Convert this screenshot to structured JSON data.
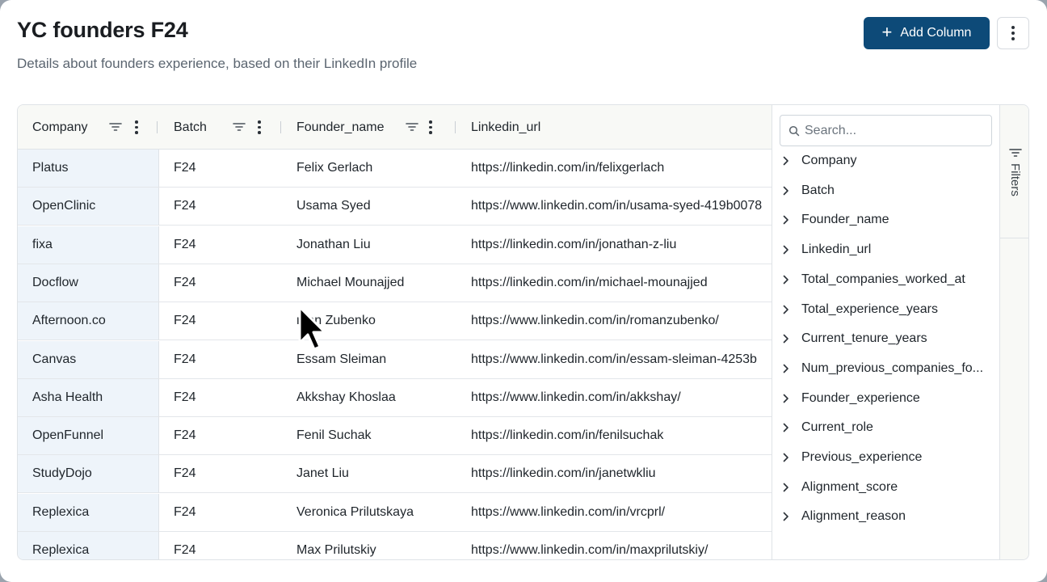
{
  "header": {
    "title": "YC founders F24",
    "subtitle": "Details about founders experience, based on their LinkedIn profile",
    "add_column_label": "Add Column"
  },
  "colors": {
    "primary_button": "#0d4a78",
    "first_column_bg": "#eef4fa",
    "header_bg": "#f8f9f6"
  },
  "table": {
    "columns": [
      "Company",
      "Batch",
      "Founder_name",
      "Linkedin_url"
    ],
    "rows": [
      {
        "company": "Platus",
        "batch": "F24",
        "founder": "Felix Gerlach",
        "linkedin": "https://linkedin.com/in/felixgerlach"
      },
      {
        "company": "OpenClinic",
        "batch": "F24",
        "founder": "Usama Syed",
        "linkedin": "https://www.linkedin.com/in/usama-syed-419b0078"
      },
      {
        "company": "fixa",
        "batch": "F24",
        "founder": "Jonathan Liu",
        "linkedin": "https://linkedin.com/in/jonathan-z-liu"
      },
      {
        "company": "Docflow",
        "batch": "F24",
        "founder": "Michael Mounajjed",
        "linkedin": "https://linkedin.com/in/michael-mounajjed"
      },
      {
        "company": "Afternoon.co",
        "batch": "F24",
        "founder": "man Zubenko",
        "linkedin": "https://www.linkedin.com/in/romanzubenko/"
      },
      {
        "company": "Canvas",
        "batch": "F24",
        "founder": "Essam Sleiman",
        "linkedin": "https://www.linkedin.com/in/essam-sleiman-4253b"
      },
      {
        "company": "Asha Health",
        "batch": "F24",
        "founder": "Akkshay Khoslaa",
        "linkedin": "https://www.linkedin.com/in/akkshay/"
      },
      {
        "company": "OpenFunnel",
        "batch": "F24",
        "founder": "Fenil Suchak",
        "linkedin": "https://linkedin.com/in/fenilsuchak"
      },
      {
        "company": "StudyDojo",
        "batch": "F24",
        "founder": "Janet Liu",
        "linkedin": "https://linkedin.com/in/janetwkliu"
      },
      {
        "company": "Replexica",
        "batch": "F24",
        "founder": "Veronica Prilutskaya",
        "linkedin": "https://www.linkedin.com/in/vrcprl/"
      },
      {
        "company": "Replexica",
        "batch": "F24",
        "founder": "Max Prilutskiy",
        "linkedin": "https://www.linkedin.com/in/maxprilutskiy/"
      }
    ]
  },
  "column_panel": {
    "search_placeholder": "Search...",
    "items": [
      "Company",
      "Batch",
      "Founder_name",
      "Linkedin_url",
      "Total_companies_worked_at",
      "Total_experience_years",
      "Current_tenure_years",
      "Num_previous_companies_fo...",
      "Founder_experience",
      "Current_role",
      "Previous_experience",
      "Alignment_score",
      "Alignment_reason"
    ]
  },
  "side_bar": {
    "filters_label": "Filters"
  }
}
